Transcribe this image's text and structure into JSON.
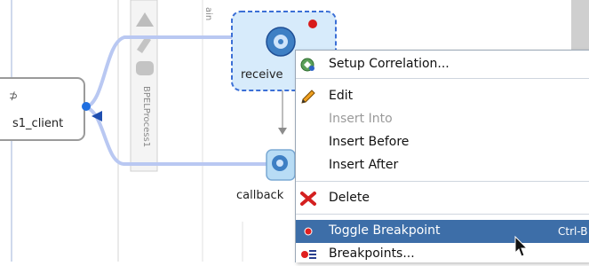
{
  "diagram": {
    "left_partner_label": "s1_client",
    "receive_label": "receive",
    "callback_label": "callback",
    "swimlane_label": "BPELProcess1",
    "partial_label": "ain"
  },
  "context_menu": {
    "items": [
      {
        "label": "Setup Correlation...",
        "icon": "correlation-icon",
        "enabled": true
      },
      {
        "label": "Edit",
        "icon": "pencil-icon",
        "enabled": true
      },
      {
        "label": "Insert Into",
        "icon": "",
        "enabled": false
      },
      {
        "label": "Insert Before",
        "icon": "",
        "enabled": true
      },
      {
        "label": "Insert After",
        "icon": "",
        "enabled": true
      },
      {
        "label": "Delete",
        "icon": "delete-x-icon",
        "enabled": true
      },
      {
        "label": "Toggle Breakpoint",
        "icon": "breakpoint-dot-icon",
        "enabled": true,
        "selected": true,
        "shortcut": "Ctrl-B"
      },
      {
        "label": "Breakpoints...",
        "icon": "breakpoints-list-icon",
        "enabled": true
      }
    ]
  },
  "colors": {
    "selection": "#3d6ea8",
    "connector": "#b9c8f2",
    "node_border": "#3b6fd6",
    "breakpoint": "#d81b1b"
  }
}
